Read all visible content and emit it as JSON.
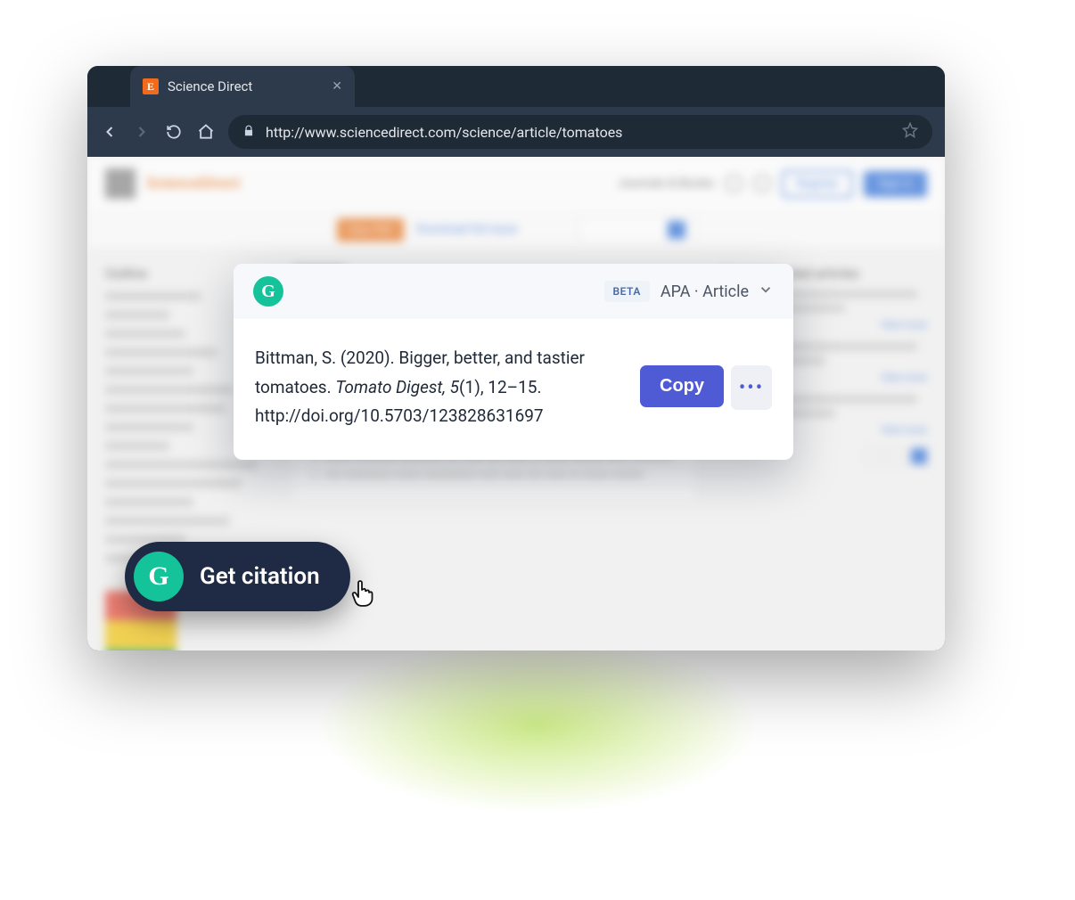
{
  "browser": {
    "tab_title": "Science Direct",
    "tab_favicon_letter": "E",
    "url": "http://www.sciencedirect.com/science/article/tomatoes"
  },
  "page_background": {
    "brand": "ScienceDirect",
    "topnav_link": "Journals & Books",
    "btn_outline": "Register",
    "btn_solid": "Sign in",
    "pdf_button": "View PDF",
    "download_link": "Download full issue",
    "outline_heading": "Outline",
    "right_heading": "Recommended articles",
    "right_more": "View more",
    "badge": "Open"
  },
  "citation": {
    "beta_label": "BETA",
    "style_label": "APA · Article",
    "text_prefix": "Bittman, S. (2020). Bigger, better, and tastier tomatoes. ",
    "text_italic": "Tomato Digest, 5",
    "text_suffix": "(1), 12–15. http://doi.org/10.5703/123828631697",
    "copy_label": "Copy",
    "more_label": "•••"
  },
  "pill": {
    "logo_letter": "G",
    "label": "Get citation"
  }
}
